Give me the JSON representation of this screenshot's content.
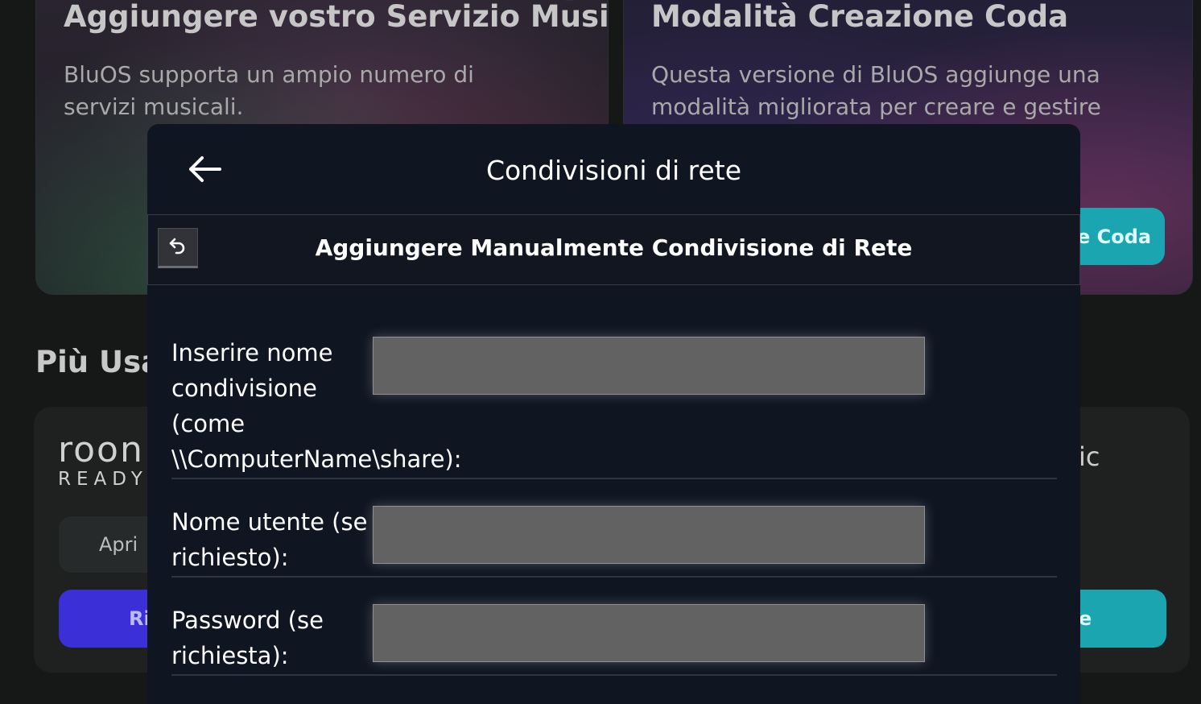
{
  "background": {
    "left_card": {
      "title": "Aggiungere vostro Servizio Musi...",
      "description": "BluOS supporta un ampio numero di servizi musicali.",
      "close_label": "×"
    },
    "right_card": {
      "title": "Modalità Creazione Coda",
      "description": "Questa versione di BluOS aggiunge una modalità migliorata per creare e gestire",
      "close_label": "×",
      "button_label": "e Coda"
    },
    "section_title": "Più Usat",
    "roon": {
      "line1": "roon",
      "line2": "READY"
    },
    "open_button_label": "Apri",
    "purple_button_label": "Ri",
    "right_partial_text": "ic",
    "teal_bottom_button_label": "e"
  },
  "modal": {
    "title": "Condivisioni di rete",
    "subtitle": "Aggiungere Manualmente Condivisione di Rete",
    "fields": [
      {
        "label": "Inserire nome\ncondivisione\n(come\n\\\\ComputerName\\share):",
        "value": "",
        "placeholder": ""
      },
      {
        "label": "Nome utente (se\nrichiesto):",
        "value": "",
        "placeholder": ""
      },
      {
        "label": "Password (se\nrichiesta):",
        "value": "",
        "placeholder": ""
      }
    ]
  },
  "colors": {
    "modal_bg": "#0f1521",
    "input_bg": "#626262",
    "teal_accent": "#1aa5b0",
    "purple_accent": "#3b2fd8"
  },
  "icons": {
    "back": "arrow-left-icon",
    "undo": "undo-icon",
    "close": "close-icon"
  }
}
